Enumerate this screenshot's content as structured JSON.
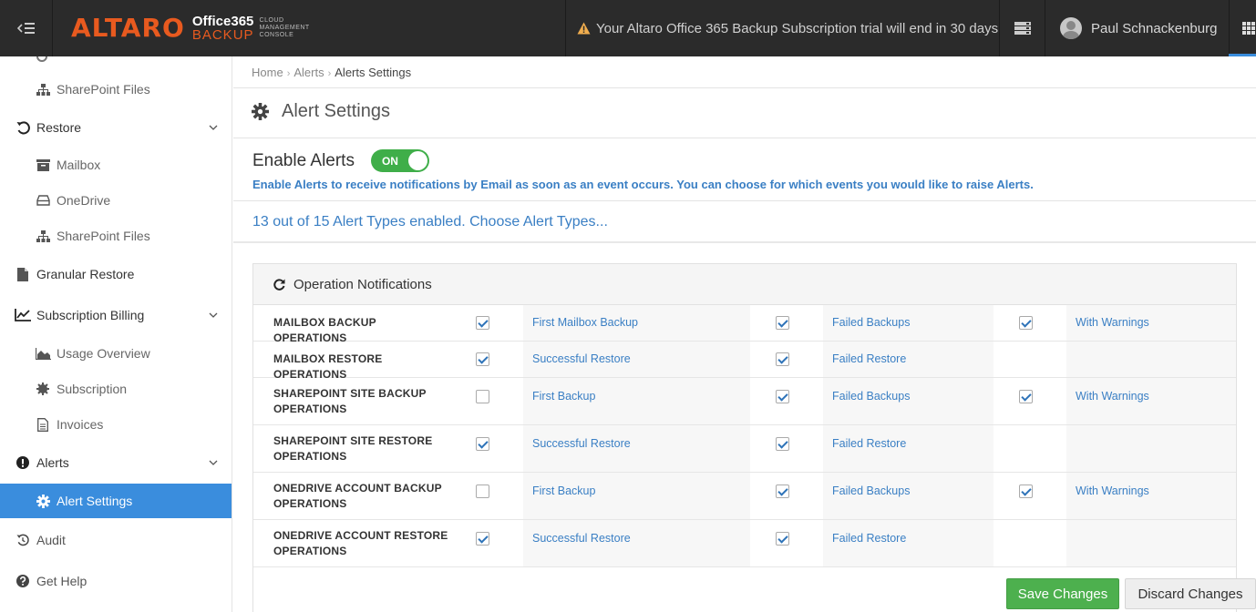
{
  "header": {
    "logo_brand": "ALTARO",
    "logo_product_line1": "Office365",
    "logo_product_line2": "BACKUP",
    "logo_console_line1": "CLOUD",
    "logo_console_line2": "MANAGEMENT",
    "logo_console_line3": "CONSOLE",
    "trial_message": "Your Altaro Office 365 Backup Subscription trial will end in 30 days",
    "user_name": "Paul Schnackenburg"
  },
  "sidebar": {
    "items": [
      {
        "label": "SharePoint Files",
        "icon": "sitemap-icon"
      },
      {
        "label": "Restore",
        "icon": "restore-icon"
      },
      {
        "label": "Mailbox",
        "icon": "archive-icon"
      },
      {
        "label": "OneDrive",
        "icon": "hdd-icon"
      },
      {
        "label": "SharePoint Files",
        "icon": "sitemap-icon"
      },
      {
        "label": "Granular Restore",
        "icon": "file-icon"
      },
      {
        "label": "Subscription Billing",
        "icon": "line-chart-icon"
      },
      {
        "label": "Usage Overview",
        "icon": "area-chart-icon"
      },
      {
        "label": "Subscription",
        "icon": "certificate-icon"
      },
      {
        "label": "Invoices",
        "icon": "invoice-icon"
      },
      {
        "label": "Alerts",
        "icon": "exclamation-circle-icon"
      },
      {
        "label": "Alert Settings",
        "icon": "gear-icon"
      },
      {
        "label": "Audit",
        "icon": "history-icon"
      },
      {
        "label": "Get Help",
        "icon": "question-circle-icon"
      }
    ]
  },
  "breadcrumb": {
    "home": "Home",
    "alerts": "Alerts",
    "current": "Alerts Settings"
  },
  "page_title": "Alert Settings",
  "enable_alerts": {
    "label": "Enable Alerts",
    "toggle": "ON",
    "help": "Enable Alerts to receive notifications by Email as soon as an event occurs. You can choose for which events you would like to raise Alerts."
  },
  "alert_types_link": "13 out of 15 Alert Types enabled. Choose Alert Types...",
  "panel": {
    "title": "Operation Notifications",
    "rows": [
      {
        "label": "MAILBOX BACKUP OPERATIONS",
        "options": [
          {
            "label": "First Mailbox Backup",
            "checked": true
          },
          {
            "label": "Failed Backups",
            "checked": true
          },
          {
            "label": "With Warnings",
            "checked": true
          }
        ]
      },
      {
        "label": "MAILBOX RESTORE OPERATIONS",
        "options": [
          {
            "label": "Successful Restore",
            "checked": true
          },
          {
            "label": "Failed Restore",
            "checked": true
          }
        ]
      },
      {
        "label": "SHAREPOINT SITE BACKUP OPERATIONS",
        "options": [
          {
            "label": "First Backup",
            "checked": false
          },
          {
            "label": "Failed Backups",
            "checked": true
          },
          {
            "label": "With Warnings",
            "checked": true
          }
        ]
      },
      {
        "label": "SHAREPOINT SITE RESTORE OPERATIONS",
        "options": [
          {
            "label": "Successful Restore",
            "checked": true
          },
          {
            "label": "Failed Restore",
            "checked": true
          }
        ]
      },
      {
        "label": "ONEDRIVE ACCOUNT BACKUP OPERATIONS",
        "options": [
          {
            "label": "First Backup",
            "checked": false
          },
          {
            "label": "Failed Backups",
            "checked": true
          },
          {
            "label": "With Warnings",
            "checked": true
          }
        ]
      },
      {
        "label": "ONEDRIVE ACCOUNT RESTORE OPERATIONS",
        "options": [
          {
            "label": "Successful Restore",
            "checked": true
          },
          {
            "label": "Failed Restore",
            "checked": true
          }
        ]
      }
    ]
  },
  "buttons": {
    "save": "Save Changes",
    "discard": "Discard Changes"
  },
  "colors": {
    "accent": "#3a8ddd",
    "brand": "#e85a1f",
    "success": "#4db04e",
    "link": "#3a7fc4"
  }
}
